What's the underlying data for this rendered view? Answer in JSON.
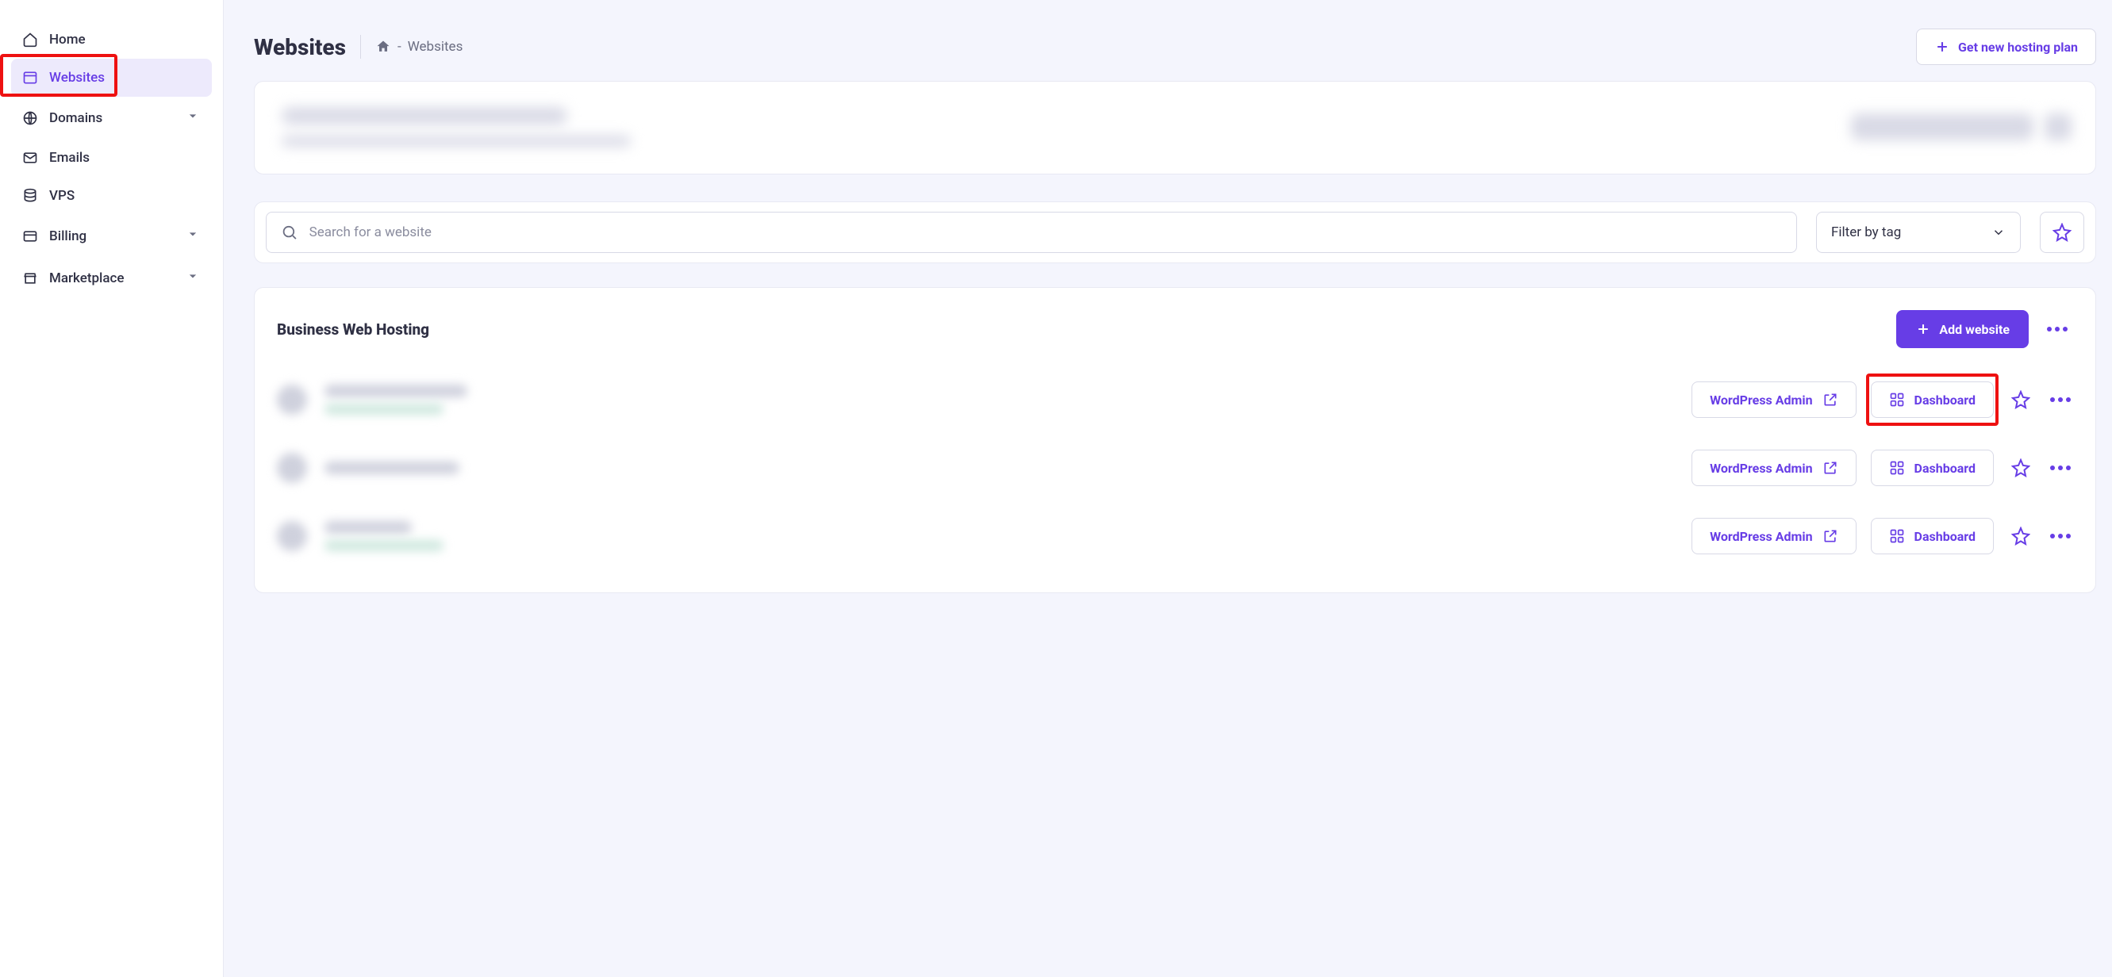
{
  "sidebar": {
    "items": [
      {
        "label": "Home"
      },
      {
        "label": "Websites"
      },
      {
        "label": "Domains"
      },
      {
        "label": "Emails"
      },
      {
        "label": "VPS"
      },
      {
        "label": "Billing"
      },
      {
        "label": "Marketplace"
      }
    ]
  },
  "header": {
    "title": "Websites",
    "crumb_sep": "-",
    "crumb_current": "Websites",
    "new_plan_label": "Get new hosting plan"
  },
  "filters": {
    "search_placeholder": "Search for a website",
    "tag_label": "Filter by tag"
  },
  "hosting": {
    "title": "Business Web Hosting",
    "add_label": "Add website",
    "wp_label": "WordPress Admin",
    "dash_label": "Dashboard"
  }
}
